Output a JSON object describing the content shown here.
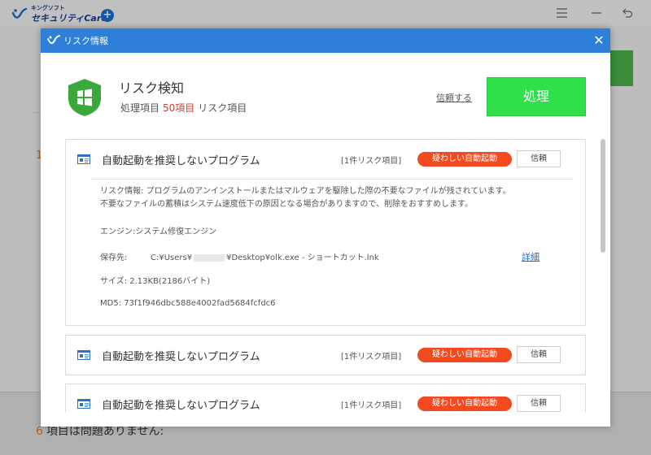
{
  "app": {
    "logo_small": "キングソフト",
    "logo_big": "セキュリティCare",
    "logo_plus": "+",
    "menu_icon": "menu-icon",
    "minimize_icon": "minimize-icon",
    "back_icon": "back-icon",
    "bg_list_number": "1",
    "bg_bottom_number": "6",
    "bg_bottom_text": "項目は問題ありません:"
  },
  "modal": {
    "title": "リスク情報",
    "close": "✕",
    "heading": "リスク検知",
    "sub_prefix": "処理項目",
    "sub_count": "50項目",
    "sub_suffix": "リスク項目",
    "trust_link": "信頼する",
    "process_button": "処理"
  },
  "cards": [
    {
      "title": "自動起動を推奨しないプログラム",
      "count": "[1件リスク項目]",
      "badge": "疑わしい自動起動",
      "trust": "信頼",
      "details": {
        "risk_label": "リスク情報:",
        "risk_text": "プログラムのアンインストールまたはマルウェアを駆除した際の不要なファイルが残されています。不要なファイルの蓄積はシステム速度低下の原因となる場合がありますので、削除をおすすめします。",
        "engine": "エンジン:システム修復エンジン",
        "path_label": "保存先:",
        "path_prefix": "C:¥Users¥",
        "path_suffix": "¥Desktop¥olk.exe - ショートカット.lnk",
        "detail_link": "詳細",
        "size": "サイズ: 2.13KB(2186バイト)",
        "md5": "MD5: 73f1f946dbc588e4002fad5684fcfdc6"
      }
    },
    {
      "title": "自動起動を推奨しないプログラム",
      "count": "[1件リスク項目]",
      "badge": "疑わしい自動起動",
      "trust": "信頼"
    },
    {
      "title": "自動起動を推奨しないプログラム",
      "count": "[1件リスク項目]",
      "badge": "疑わしい自動起動",
      "trust": "信頼"
    }
  ],
  "colors": {
    "titlebar": "#2e7fd9",
    "process_button": "#2fe04a",
    "badge": "#f44a1f",
    "count_highlight": "#e2332a",
    "shield": "#3aa83a",
    "link": "#1f6ad4"
  }
}
